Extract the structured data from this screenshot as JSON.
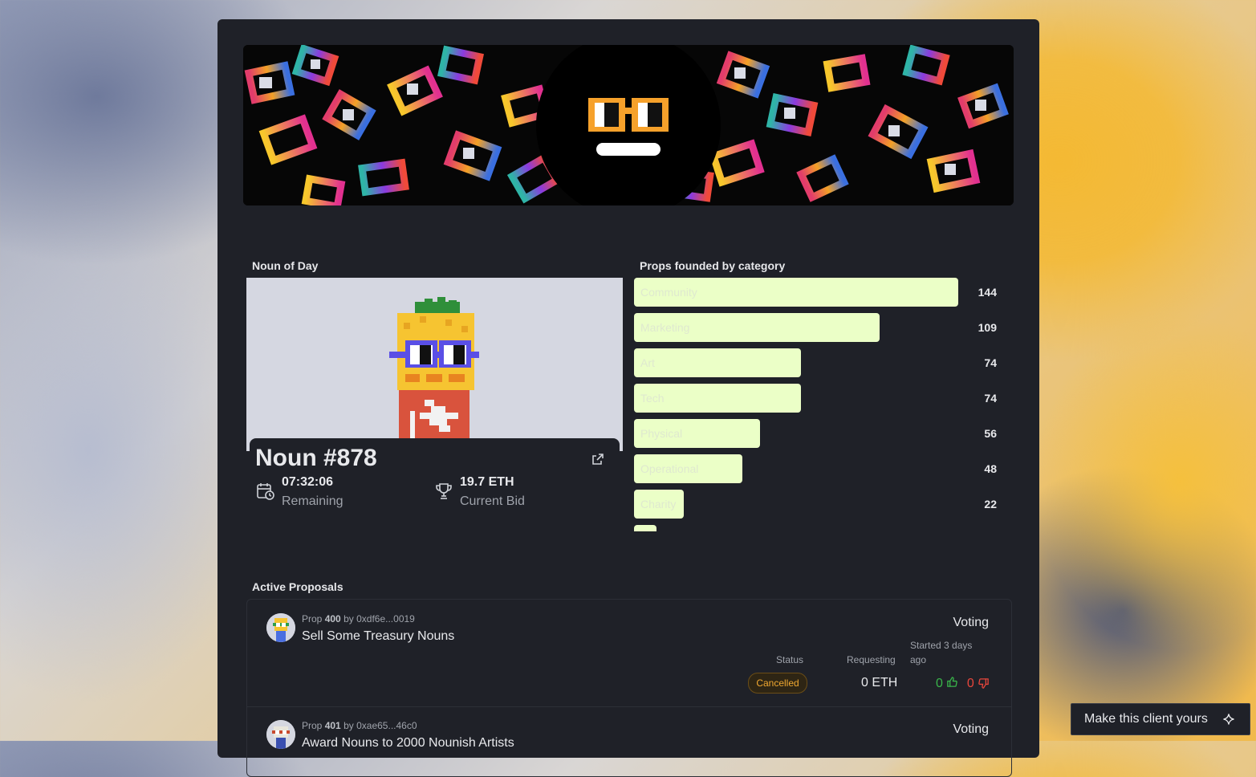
{
  "noun_of_day": {
    "section_title": "Noun of Day",
    "name": "Noun #878",
    "timer_value": "07:32:06",
    "timer_label": "Remaining",
    "bid_value": "19.7 ETH",
    "bid_label": "Current Bid",
    "icons": {
      "link": "external-link-icon",
      "timer": "calendar-clock-icon",
      "bid": "trophy-icon"
    }
  },
  "categories": {
    "section_title": "Props founded by category",
    "max": 144,
    "bar_color": "#ebffc7",
    "items": [
      {
        "label": "Community",
        "count": "144",
        "value": 144
      },
      {
        "label": "Marketing",
        "count": "109",
        "value": 109
      },
      {
        "label": "Art",
        "count": "74",
        "value": 74
      },
      {
        "label": "Tech",
        "count": "74",
        "value": 74
      },
      {
        "label": "Physical",
        "count": "56",
        "value": 56
      },
      {
        "label": "Operational",
        "count": "48",
        "value": 48
      },
      {
        "label": "Charity",
        "count": "22",
        "value": 22
      },
      {
        "label": "",
        "count": "",
        "value": 10
      }
    ]
  },
  "proposals": {
    "section_title": "Active Proposals",
    "status_header": "Status",
    "requesting_header": "Requesting",
    "items": [
      {
        "prefix": "Prop",
        "number": "400",
        "by": "by",
        "author": "0xdf6e...0019",
        "title": "Sell Some Treasury Nouns",
        "state": "Voting",
        "started_line1": "Started 3 days",
        "started_line2": "ago",
        "status": "Cancelled",
        "requesting": "0 ETH",
        "votes_for": "0",
        "votes_against": "0"
      },
      {
        "prefix": "Prop",
        "number": "401",
        "by": "by",
        "author": "0xae65...46c0",
        "title": "Award Nouns to 2000 Nounish Artists",
        "state": "Voting"
      }
    ]
  },
  "cta": {
    "label": "Make this client yours",
    "icon": "sparkle-icon"
  },
  "colors": {
    "panel": "#1f2128",
    "accent_status": "#f0a830",
    "vote_for": "#39b54a",
    "vote_against": "#e6463c"
  }
}
